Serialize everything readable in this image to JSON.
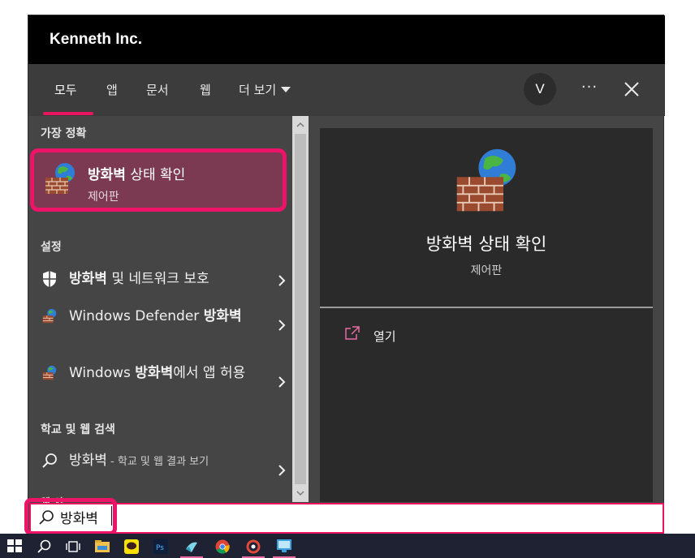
{
  "window": {
    "org_name": "Kenneth Inc."
  },
  "tabs": [
    {
      "label": "모두",
      "active": true
    },
    {
      "label": "앱",
      "active": false
    },
    {
      "label": "문서",
      "active": false
    },
    {
      "label": "웹",
      "active": false
    },
    {
      "label": "더 보기",
      "active": false,
      "has_dropdown": true
    }
  ],
  "header_actions": {
    "avatar_initial": "V",
    "more_label": "···",
    "close_icon": "close-icon"
  },
  "sections": {
    "best_match": "가장 정확",
    "settings": "설정",
    "web_search": "학교 및 웹 검색",
    "cut_off": "웹 사"
  },
  "best_match": {
    "title_bold": "방화벽",
    "title_rest": " 상태 확인",
    "subtitle": "제어판",
    "icon": "firewall-globe-icon"
  },
  "settings_results": [
    {
      "icon": "shield-icon",
      "bold": "방화벽",
      "rest": " 및 네트워크 보호"
    },
    {
      "icon": "firewall-globe-icon",
      "pre": "Windows Defender ",
      "bold": "방화벽",
      "rest": ""
    },
    {
      "icon": "firewall-globe-icon",
      "pre": "Windows ",
      "bold": "방화벽",
      "rest": "에서 앱 허용"
    }
  ],
  "web_result": {
    "icon": "search-icon",
    "query": "방화벽",
    "suffix": " - 학교 및 웹 결과 보기"
  },
  "preview": {
    "title": "방화벽 상태 확인",
    "subtitle": "제어판",
    "open_label": "열기",
    "open_icon": "open-external-icon"
  },
  "search": {
    "value": "방화벽",
    "icon": "search-icon"
  },
  "colors": {
    "accent": "#e8145e",
    "selected_bg": "#7c3a52",
    "panel_bg": "#454545",
    "preview_bg": "#2b2a2b",
    "taskbar_bg": "#1f2233"
  },
  "taskbar": [
    {
      "name": "windows-start-icon"
    },
    {
      "name": "search-icon"
    },
    {
      "name": "task-view-icon"
    },
    {
      "name": "file-explorer-icon"
    },
    {
      "name": "kakaotalk-icon"
    },
    {
      "name": "photoshop-icon"
    },
    {
      "name": "app-icon"
    },
    {
      "name": "chrome-icon"
    },
    {
      "name": "app-icon"
    },
    {
      "name": "control-panel-icon"
    }
  ]
}
